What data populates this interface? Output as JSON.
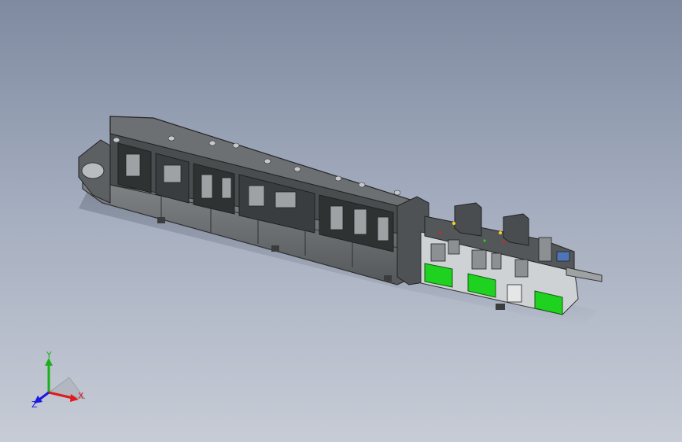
{
  "viewport": {
    "background_top": "#7f8aa0",
    "background_bottom": "#c7ccd6",
    "model": {
      "frame_color": "#3c3e3f",
      "panel_color": "#7d8082",
      "accent_color": "#1fd21f"
    }
  },
  "triad": {
    "x_label": "X",
    "y_label": "Y",
    "z_label": "Z",
    "x_color": "#e01a1a",
    "y_color": "#1ab01a",
    "z_color": "#1a1ae0"
  }
}
